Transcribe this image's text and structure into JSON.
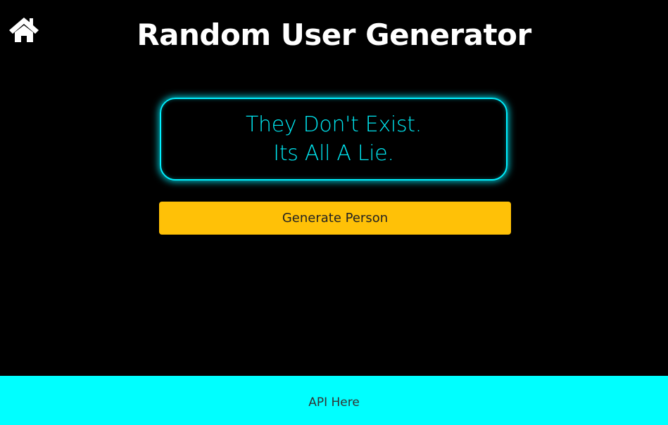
{
  "header": {
    "home_icon": "home-icon",
    "title": "Random User Generator"
  },
  "main": {
    "message_lines": [
      "They Don't Exist.",
      "Its All A Lie."
    ],
    "generate_button_label": "Generate Person"
  },
  "footer": {
    "link_label": "API Here"
  },
  "colors": {
    "background": "#000000",
    "title": "#ffffff",
    "neon_accent": "#00f0ff",
    "button": "#ffc107",
    "footer": "#00ffff"
  }
}
